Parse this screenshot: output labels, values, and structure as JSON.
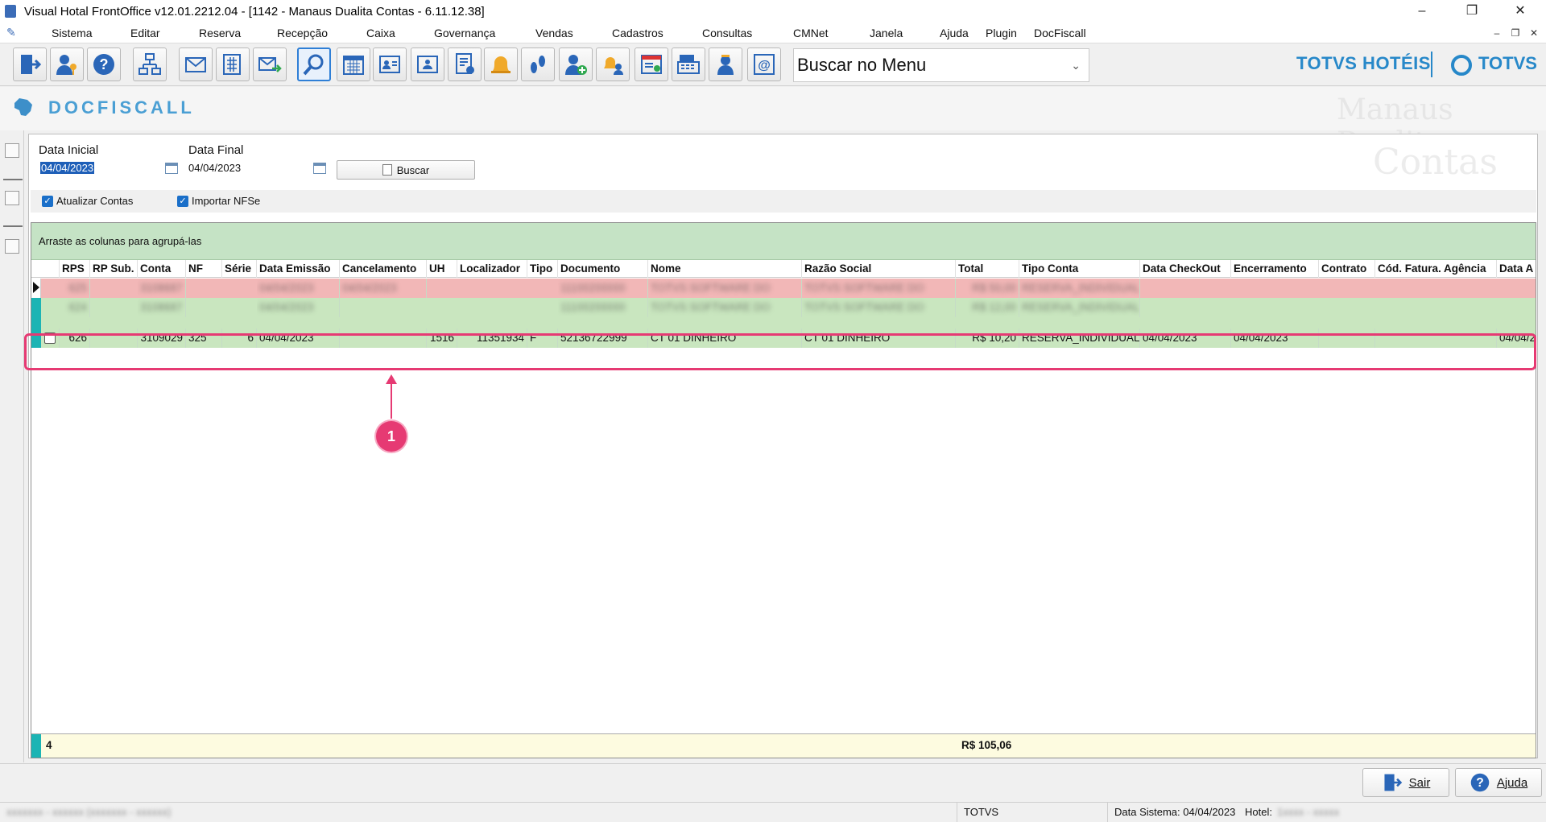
{
  "window": {
    "title": "Visual Hotal FrontOffice v12.01.2212.04 - [1142 - Manaus Dualita Contas - 6.11.12.38]",
    "minimize": "–",
    "restore": "❐",
    "close": "✕"
  },
  "menu": {
    "items": [
      "Sistema",
      "Editar",
      "Reserva",
      "Recepção",
      "Caixa",
      "Governança",
      "Vendas",
      "Cadastros",
      "Consultas",
      "CMNet",
      "Janela",
      "Ajuda",
      "Plugin",
      "DocFiscall"
    ],
    "mdi_minimize": "–",
    "mdi_restore": "❐",
    "mdi_close": "✕"
  },
  "toolbar": {
    "search_value": "Buscar no Menu",
    "brand_hotels": "TOTVS HOTÉIS",
    "brand_totvs": "TOTVS",
    "icons": [
      "exit-icon",
      "user-key-icon",
      "help-icon",
      "org-chart-icon",
      "mail-icon",
      "calculator-icon",
      "send-mail-icon",
      "search-icon",
      "calendar-icon",
      "guest-card-icon",
      "checkin-card-icon",
      "report-icon",
      "bell-icon",
      "footprints-icon",
      "add-user-icon",
      "housekeeping-icon",
      "invoice-icon",
      "cash-register-icon",
      "maid-icon",
      "email-at-icon"
    ]
  },
  "module": {
    "name": "DOCFISCALL",
    "hotel_watermark": "Manaus Dualita",
    "screen_watermark": "Contas"
  },
  "filters": {
    "data_inicial_label": "Data Inicial",
    "data_inicial_value": "04/04/2023",
    "data_final_label": "Data Final",
    "data_final_value": "04/04/2023",
    "buscar_label": "Buscar",
    "atualizar_contas_label": "Atualizar Contas",
    "importar_nfse_label": "Importar NFSe",
    "atualizar_contas_checked": true,
    "importar_nfse_checked": true
  },
  "grid": {
    "group_hint": "Arraste as colunas para agrupá-las",
    "columns": [
      "RPS",
      "RP Sub.",
      "Conta",
      "NF",
      "Série",
      "Data Emissão",
      "Cancelamento",
      "UH",
      "Localizador",
      "Tipo",
      "Documento",
      "Nome",
      "Razão Social",
      "Total",
      "Tipo Conta",
      "Data CheckOut",
      "Encerramento",
      "Contrato",
      "Cód. Fatura. Agência",
      "Data A"
    ],
    "visible_row": {
      "rps": "626",
      "rp_sub": "",
      "conta": "3109029",
      "nf": "325",
      "serie": "6",
      "data_emissao": "04/04/2023",
      "cancelamento": "",
      "uh": "1516",
      "localizador": "11351934",
      "tipo": "F",
      "documento": "52136722999",
      "nome": "CT 01 DINHEIRO",
      "razao_social": "CT 01 DINHEIRO",
      "total": "R$ 10,20",
      "tipo_conta": "RESERVA_INDIVIDUAL",
      "data_checkout": "04/04/2023",
      "encerramento": "04/04/2023",
      "contrato": "",
      "cod_fatura_agencia": "",
      "data_a": "04/04/2"
    },
    "row_colors": {
      "cancelled": "#f2b7b7",
      "normal": "#c9e6bf",
      "indicator": "#1cb4b4"
    },
    "footer_count": "4",
    "footer_total": "R$ 105,06"
  },
  "annotation": {
    "badge": "1",
    "accent": "#e63a73"
  },
  "buttons": {
    "sair": "Sair",
    "ajuda": "Ajuda"
  },
  "status": {
    "company": "TOTVS",
    "data_sistema": "Data Sistema: 04/04/2023",
    "hotel_label": "Hotel:"
  }
}
